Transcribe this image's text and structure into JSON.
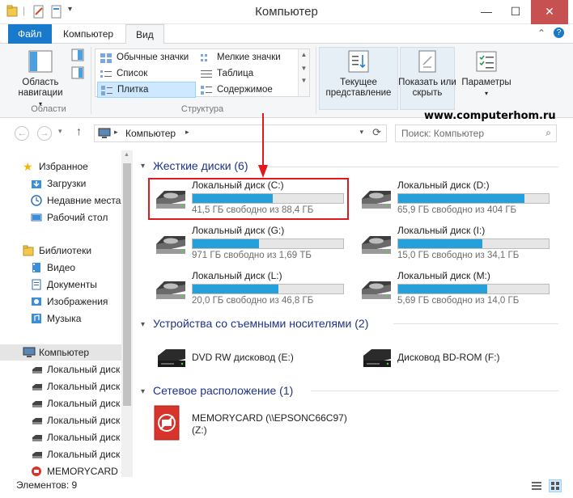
{
  "window": {
    "title": "Компьютер"
  },
  "ribbon_tabs": [
    {
      "label": "Файл"
    },
    {
      "label": "Компьютер"
    },
    {
      "label": "Вид"
    }
  ],
  "ribbon": {
    "areas": {
      "nav_pane_label": "Область навигации",
      "group_label": "Области"
    },
    "layout": {
      "items": [
        {
          "label": "Обычные значки"
        },
        {
          "label": "Мелкие значки"
        },
        {
          "label": "Список"
        },
        {
          "label": "Таблица"
        },
        {
          "label": "Плитка"
        },
        {
          "label": "Содержимое"
        }
      ],
      "group_label": "Структура"
    },
    "current_view": {
      "label": "Текущее представление"
    },
    "show_hide": {
      "label": "Показать или скрыть"
    },
    "options": {
      "label": "Параметры"
    }
  },
  "address": {
    "path": "Компьютер",
    "search_placeholder": "Поиск: Компьютер"
  },
  "watermark": "www.computerhom.ru",
  "nav_pane": {
    "favorites": {
      "label": "Избранное",
      "items": [
        "Загрузки",
        "Недавние места",
        "Рабочий стол"
      ]
    },
    "libraries": {
      "label": "Библиотеки",
      "items": [
        "Видео",
        "Документы",
        "Изображения",
        "Музыка"
      ]
    },
    "computer": {
      "label": "Компьютер",
      "items": [
        "Локальный диск",
        "Локальный диск",
        "Локальный диск",
        "Локальный диск",
        "Локальный диск",
        "Локальный диск",
        "MEMORYCARD ("
      ]
    }
  },
  "groups": {
    "hard_disks": {
      "label": "Жесткие диски (6)",
      "drives": [
        {
          "name": "Локальный диск (C:)",
          "free": "41,5 ГБ свободно из 88,4 ГБ",
          "used_fraction": 0.53
        },
        {
          "name": "Локальный диск (D:)",
          "free": "65,9 ГБ свободно из 404 ГБ",
          "used_fraction": 0.84
        },
        {
          "name": "Локальный диск (G:)",
          "free": "971 ГБ свободно из 1,69 ТБ",
          "used_fraction": 0.44
        },
        {
          "name": "Локальный диск (I:)",
          "free": "15,0 ГБ свободно из 34,1 ГБ",
          "used_fraction": 0.56
        },
        {
          "name": "Локальный диск (L:)",
          "free": "20,0 ГБ свободно из 46,8 ГБ",
          "used_fraction": 0.57
        },
        {
          "name": "Локальный диск (M:)",
          "free": "5,69 ГБ свободно из 14,0 ГБ",
          "used_fraction": 0.59
        }
      ]
    },
    "removable": {
      "label": "Устройства со съемными носителями (2)",
      "devices": [
        {
          "name": "DVD RW дисковод (E:)"
        },
        {
          "name": "Дисковод BD-ROM (F:)"
        }
      ]
    },
    "network": {
      "label": "Сетевое расположение (1)",
      "items": [
        {
          "name_line1": "MEMORYCARD (\\\\EPSONC66C97)",
          "name_line2": "(Z:)"
        }
      ]
    }
  },
  "status": {
    "items_count": "Элементов: 9"
  },
  "colors": {
    "accent": "#1979ca",
    "bar_fill": "#26a0da",
    "highlight": "#e0191f",
    "group_heading": "#1e3287"
  }
}
